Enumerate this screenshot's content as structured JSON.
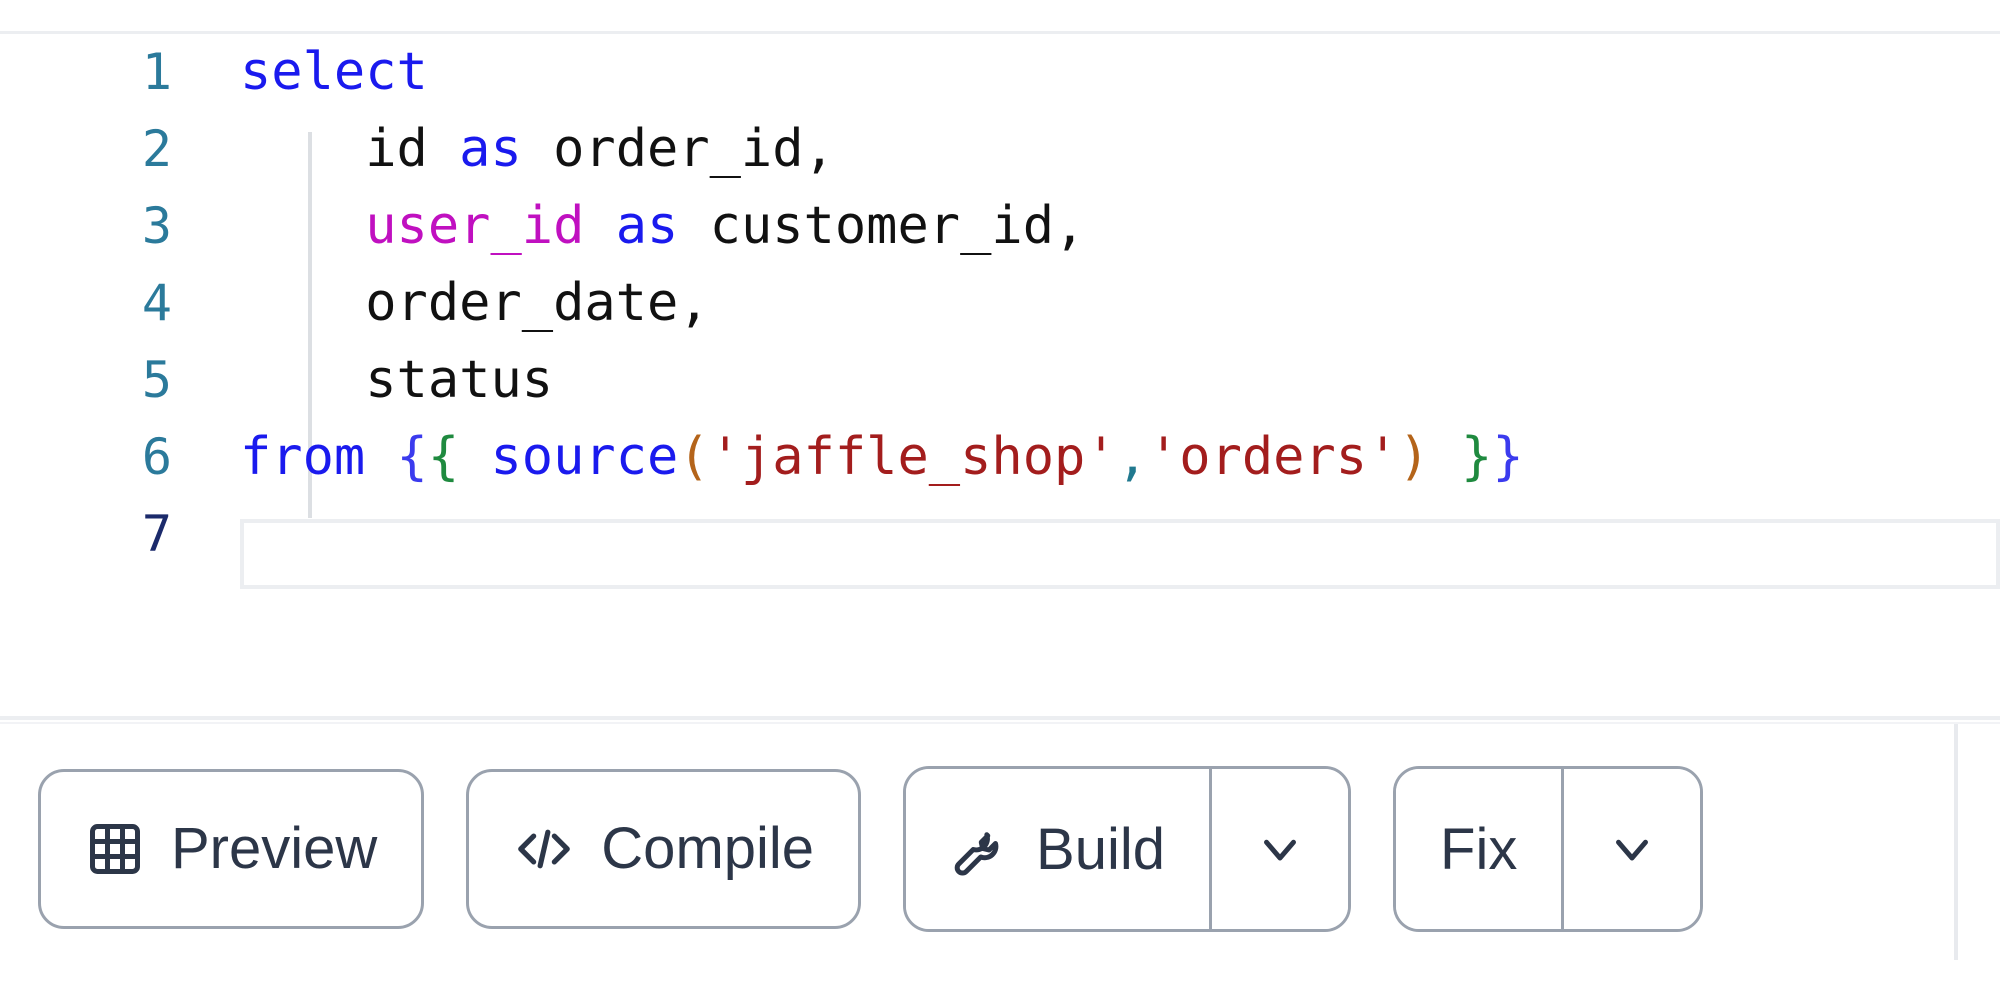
{
  "editor": {
    "name": "sql-code-editor",
    "language": "sql",
    "active_line": 7,
    "gutter_numbers": [
      "1",
      "2",
      "3",
      "4",
      "5",
      "6",
      "7"
    ],
    "lines": [
      {
        "number": "1",
        "text": "select",
        "tokens": [
          {
            "t": "select",
            "c": "t-kw"
          }
        ]
      },
      {
        "number": "2",
        "text": "    id as order_id,",
        "tokens": [
          {
            "t": "    id ",
            "c": "t-plain"
          },
          {
            "t": "as",
            "c": "t-kw"
          },
          {
            "t": " order_id,",
            "c": "t-plain"
          }
        ]
      },
      {
        "number": "3",
        "text": "    user_id as customer_id,",
        "tokens": [
          {
            "t": "    ",
            "c": "t-plain"
          },
          {
            "t": "user_id",
            "c": "t-col"
          },
          {
            "t": " ",
            "c": "t-plain"
          },
          {
            "t": "as",
            "c": "t-kw"
          },
          {
            "t": " customer_id,",
            "c": "t-plain"
          }
        ]
      },
      {
        "number": "4",
        "text": "    order_date,",
        "tokens": [
          {
            "t": "    order_date,",
            "c": "t-plain"
          }
        ]
      },
      {
        "number": "5",
        "text": "    status",
        "tokens": [
          {
            "t": "    status",
            "c": "t-plain"
          }
        ]
      },
      {
        "number": "6",
        "text": "from {{ source('jaffle_shop','orders') }}",
        "tokens": [
          {
            "t": "from",
            "c": "t-kw"
          },
          {
            "t": " ",
            "c": "t-plain"
          },
          {
            "t": "{",
            "c": "t-jb1"
          },
          {
            "t": "{",
            "c": "t-jb2"
          },
          {
            "t": " ",
            "c": "t-plain"
          },
          {
            "t": "source",
            "c": "t-kw"
          },
          {
            "t": "(",
            "c": "t-paren"
          },
          {
            "t": "'jaffle_shop'",
            "c": "t-str"
          },
          {
            "t": ",",
            "c": "t-punc"
          },
          {
            "t": "'orders'",
            "c": "t-str"
          },
          {
            "t": ")",
            "c": "t-paren"
          },
          {
            "t": " ",
            "c": "t-plain"
          },
          {
            "t": "}",
            "c": "t-jb2"
          },
          {
            "t": "}",
            "c": "t-jb1"
          }
        ]
      },
      {
        "number": "7",
        "text": "",
        "tokens": []
      }
    ]
  },
  "toolbar": {
    "buttons": [
      {
        "id": "preview",
        "label": "Preview",
        "icon": "table-icon",
        "has_dropdown": false
      },
      {
        "id": "compile",
        "label": "Compile",
        "icon": "code-brackets-icon",
        "has_dropdown": false
      },
      {
        "id": "build",
        "label": "Build",
        "icon": "wrench-icon",
        "has_dropdown": true
      },
      {
        "id": "fix",
        "label": "Fix",
        "icon": null,
        "has_dropdown": true
      }
    ],
    "dropdown_icon": "chevron-down-icon"
  },
  "colors": {
    "keyword": "#1a1aee",
    "column": "#c010c0",
    "string": "#a31d1d",
    "paren": "#b4641a",
    "punctuation": "#21798f",
    "jinja_outer_brace": "#3b3bee",
    "jinja_inner_brace": "#1f8a3f",
    "gutter_number": "#2b7a9b",
    "gutter_number_active": "#1b2a6b",
    "divider": "#eceef1",
    "button_border": "#9aa2ae",
    "button_text": "#2c3648",
    "indent_guide": "#dcdfe3",
    "editor_background": "#ffffff"
  }
}
